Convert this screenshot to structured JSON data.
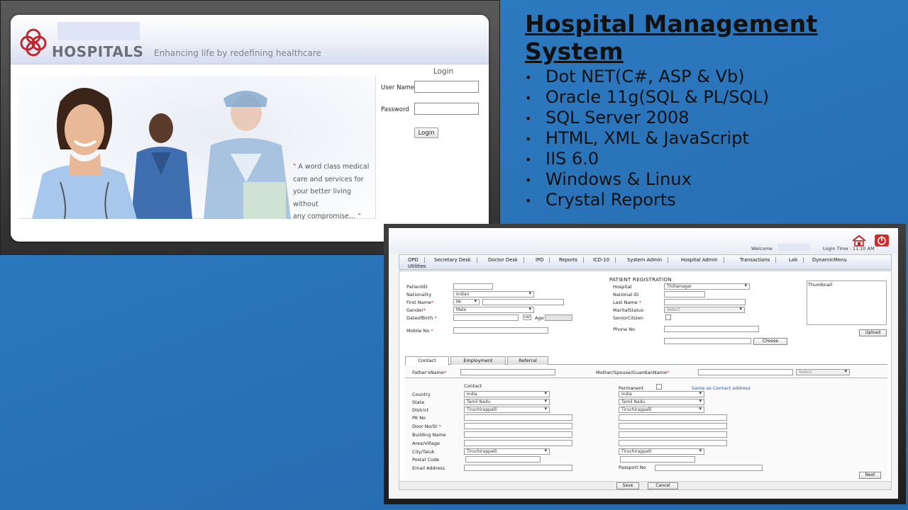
{
  "slide": {
    "title": "Hospital Management System",
    "bullets": [
      "Dot NET(C#, ASP & Vb)",
      "Oracle 11g(SQL & PL/SQL)",
      "SQL Server 2008",
      "HTML, XML & JavaScript",
      "IIS 6.0",
      "Windows & Linux",
      "Crystal Reports"
    ],
    "bullet_char": "•",
    "text_color": "#111111",
    "background_color": "#2f7fc4"
  },
  "login_screen": {
    "brand": "HOSPITALS",
    "tagline": "Enhancing life by redefining healthcare",
    "form_title": "Login",
    "username_label": "User Name",
    "password_label": "Password",
    "login_button": "Login",
    "quote_lines": [
      "A word class medical",
      "care and services for",
      "your better living without",
      "any compromise..."
    ],
    "quote_mark": "\"",
    "logo_color": "#c0272d"
  },
  "registration_screen": {
    "welcome_label": "Welcome",
    "login_time": "Login Time : 11:10 AM",
    "menu": [
      "OPD",
      "Secretary Desk",
      "Doctor Desk",
      "IPD",
      "Reports",
      "ICD-10",
      "System Admin",
      "Hospital Admin",
      "Transactions",
      "Lab",
      "DynamicMenu",
      "Utilities"
    ],
    "section_title": "PATIENT REGISTRATION",
    "labels": {
      "patient_id": "PatientID",
      "hospital": "Hospital",
      "nationality": "Nationality",
      "national_id": "National ID",
      "first_name": "First Name",
      "last_name": "Last Name",
      "gender": "Gender",
      "marital_status": "MaritalStatus",
      "dob": "DateofBirth",
      "senior_citizen": "SeniorCitizen",
      "age": "Age",
      "mobile": "Mobile No",
      "phone": "Phone No",
      "thumbnail": "Thumbnail",
      "required_mark": "*"
    },
    "values": {
      "hospital": "Thillainagar",
      "nationality": "Indian",
      "title": "Mr",
      "gender": "Male",
      "marital_status": "Select",
      "calendar_icon": "cal"
    },
    "buttons": {
      "upload": "Upload",
      "choose": "Choose",
      "next": "Next",
      "save": "Save",
      "cancel": "Cancel"
    },
    "tabs": [
      "Contact",
      "Employment",
      "Referral"
    ],
    "fathers_name_label": "Father'sName",
    "mother_label": "Mother/Spouse/GuardianName",
    "mother_select": "Select",
    "contact": {
      "contact_heading": "Contact",
      "permanent_label": "Permanent",
      "same_as_link": "Same as Contact address",
      "country_label": "Country",
      "state_label": "State",
      "district_label": "District",
      "pk_label": "PK No",
      "door_label": "Door No/St",
      "building_label": "Building Name",
      "area_label": "Area/Village",
      "city_label": "City/Taluk",
      "postal_label": "Postal Code",
      "email_label": "Email Address",
      "passport_label": "Passport No",
      "country": "India",
      "state": "Tamil Nadu",
      "district": "Tiruchirappalli",
      "city": "Tiruchirappalli"
    }
  }
}
